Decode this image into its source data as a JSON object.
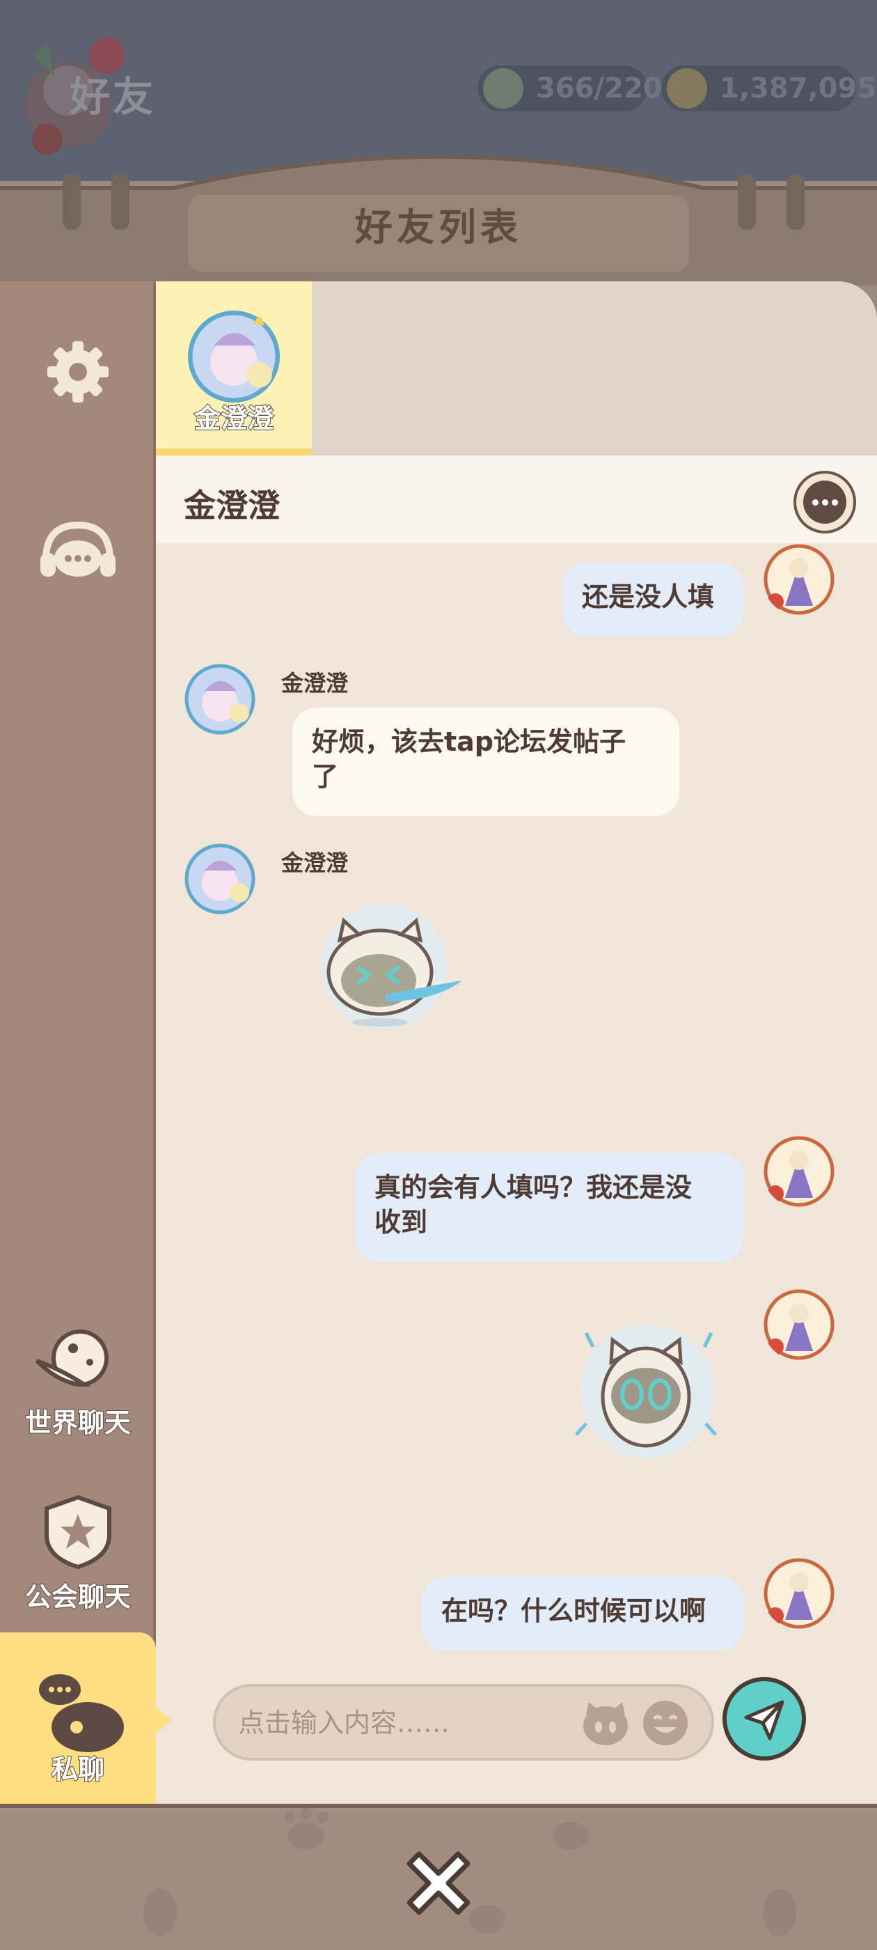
{
  "header": {
    "title": "好友",
    "stamina": "366/220",
    "coins": "1,387,095",
    "panel_title": "好友列表"
  },
  "sidebar": {
    "world_chat": "世界聊天",
    "guild_chat": "公会聊天",
    "private_chat": "私聊"
  },
  "friends": [
    {
      "name": "金澄澄",
      "selected": true
    }
  ],
  "chat": {
    "partner_name": "金澄澄",
    "messages": [
      {
        "from": "me",
        "type": "text",
        "text": "还是没人填"
      },
      {
        "from": "them",
        "sender": "金澄澄",
        "type": "text",
        "text_line1": "好烦，该去tap论坛发帖子",
        "text_line2": "了"
      },
      {
        "from": "them",
        "sender": "金澄澄",
        "type": "sticker",
        "sticker": "crying-cat-sticker"
      },
      {
        "from": "me",
        "type": "text",
        "text_line1": "真的会有人填吗？我还是没",
        "text_line2": "收到"
      },
      {
        "from": "me",
        "type": "sticker",
        "sticker": "shocked-cat-sticker"
      },
      {
        "from": "me",
        "type": "text",
        "text": "在吗？什么时候可以啊"
      }
    ]
  },
  "input": {
    "placeholder": "点击输入内容……",
    "value": ""
  },
  "colors": {
    "accent_teal": "#5fcfca",
    "selected_tab": "#fddf82",
    "panel_bg": "#f0e5d9",
    "sidebar_bg": "#a3887c",
    "my_bubble": "#e3ecf9",
    "their_bubble": "#fef9ee"
  }
}
